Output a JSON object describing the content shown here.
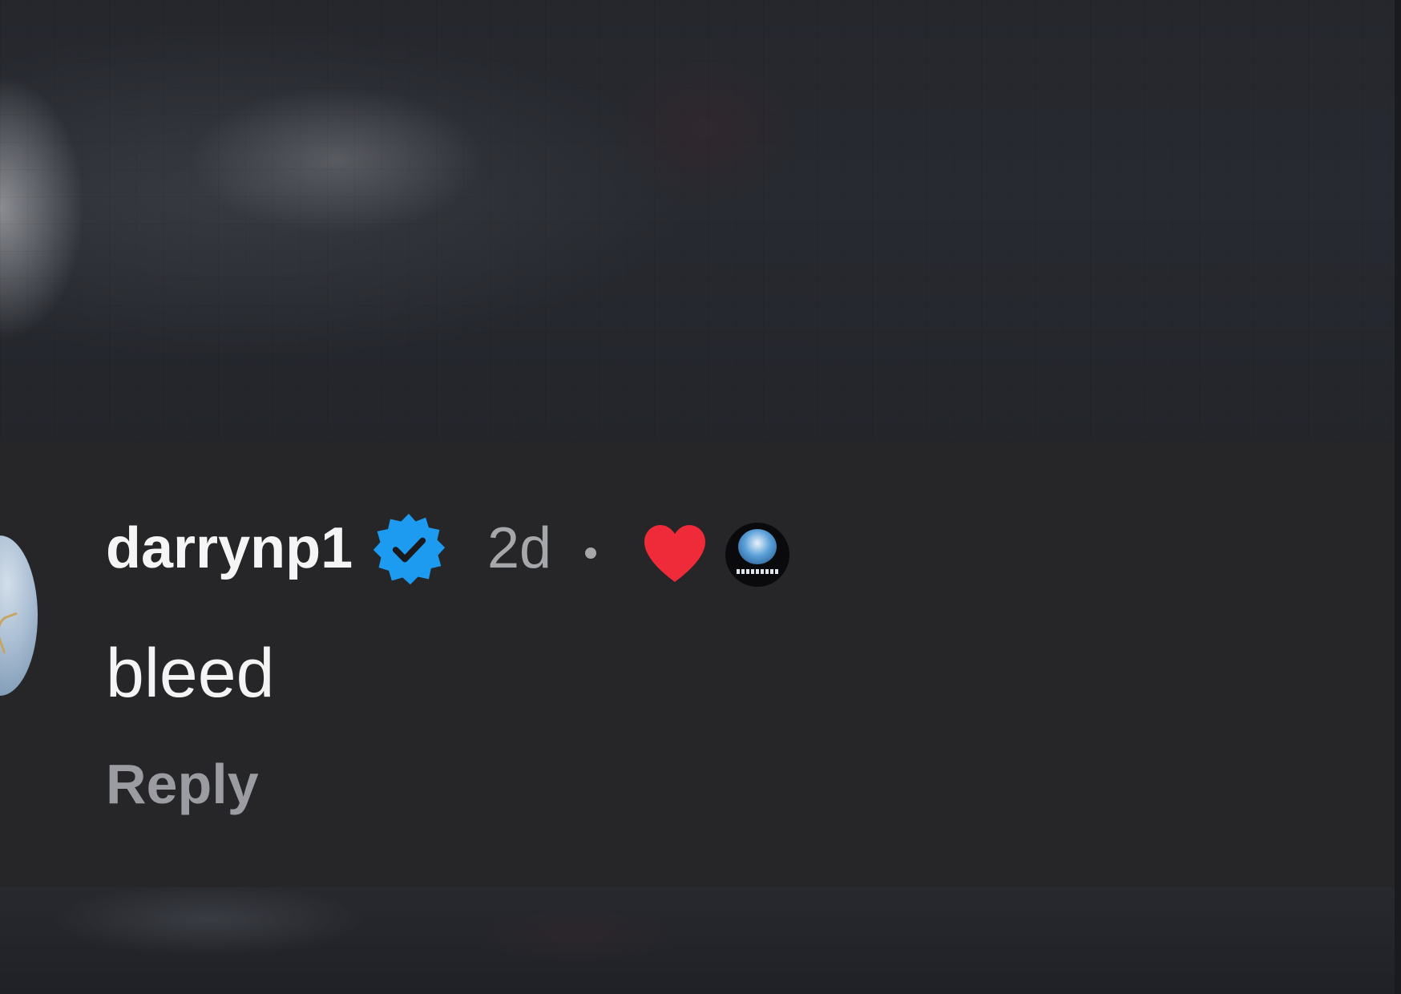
{
  "comment": {
    "username": "darrynp1",
    "verified": true,
    "timestamp": "2d",
    "separator": "•",
    "text": "bleed",
    "reply_label": "Reply",
    "liked_by_creator": true,
    "icons": {
      "verified": "verified-badge-icon",
      "like": "heart-icon",
      "liker": "creator-avatar-icon"
    },
    "colors": {
      "verified": "#1d9bf0",
      "heart": "#ef2b3a",
      "username": "#f5f5f5",
      "meta": "#a6a7ab",
      "reply": "#9a9ca1",
      "panel_background": "#262628"
    }
  }
}
